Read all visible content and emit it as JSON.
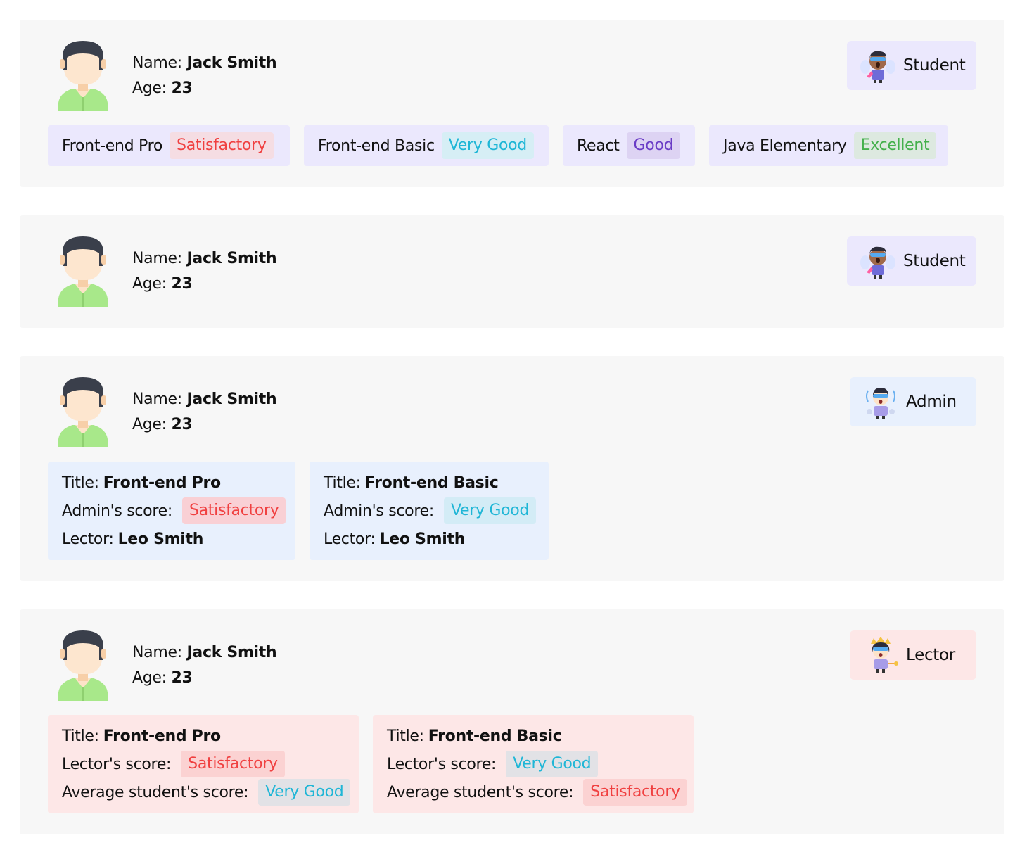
{
  "labels": {
    "name": "Name:",
    "age": "Age:",
    "title": "Title:",
    "admin_score": "Admin's score:",
    "lector": "Lector:",
    "lector_score": "Lector's score:",
    "avg_student_score": "Average student's score:"
  },
  "icons": {
    "avatar": "user-avatar-icon",
    "student": "student-hero-icon",
    "admin": "admin-hero-icon",
    "lector": "lector-hero-icon"
  },
  "colors": {
    "satisfactory": "#f04040",
    "very_good": "#1fb6d6",
    "good": "#6a3cc6",
    "excellent": "#44b04c"
  },
  "cards": [
    {
      "name": "Jack Smith",
      "age": "23",
      "role": "Student",
      "courses": [
        {
          "title": "Front-end Pro",
          "score": "Satisfactory"
        },
        {
          "title": "Front-end Basic",
          "score": "Very Good"
        },
        {
          "title": "React",
          "score": "Good"
        },
        {
          "title": "Java Elementary",
          "score": "Excellent"
        }
      ]
    },
    {
      "name": "Jack Smith",
      "age": "23",
      "role": "Student"
    },
    {
      "name": "Jack Smith",
      "age": "23",
      "role": "Admin",
      "courses": [
        {
          "title": "Front-end Pro",
          "score": "Satisfactory",
          "lector": "Leo Smith"
        },
        {
          "title": "Front-end Basic",
          "score": "Very Good",
          "lector": "Leo Smith"
        }
      ]
    },
    {
      "name": "Jack Smith",
      "age": "23",
      "role": "Lector",
      "courses": [
        {
          "title": "Front-end Pro",
          "lector_score": "Satisfactory",
          "avg_score": "Very Good"
        },
        {
          "title": "Front-end Basic",
          "lector_score": "Very Good",
          "avg_score": "Satisfactory"
        }
      ]
    }
  ]
}
